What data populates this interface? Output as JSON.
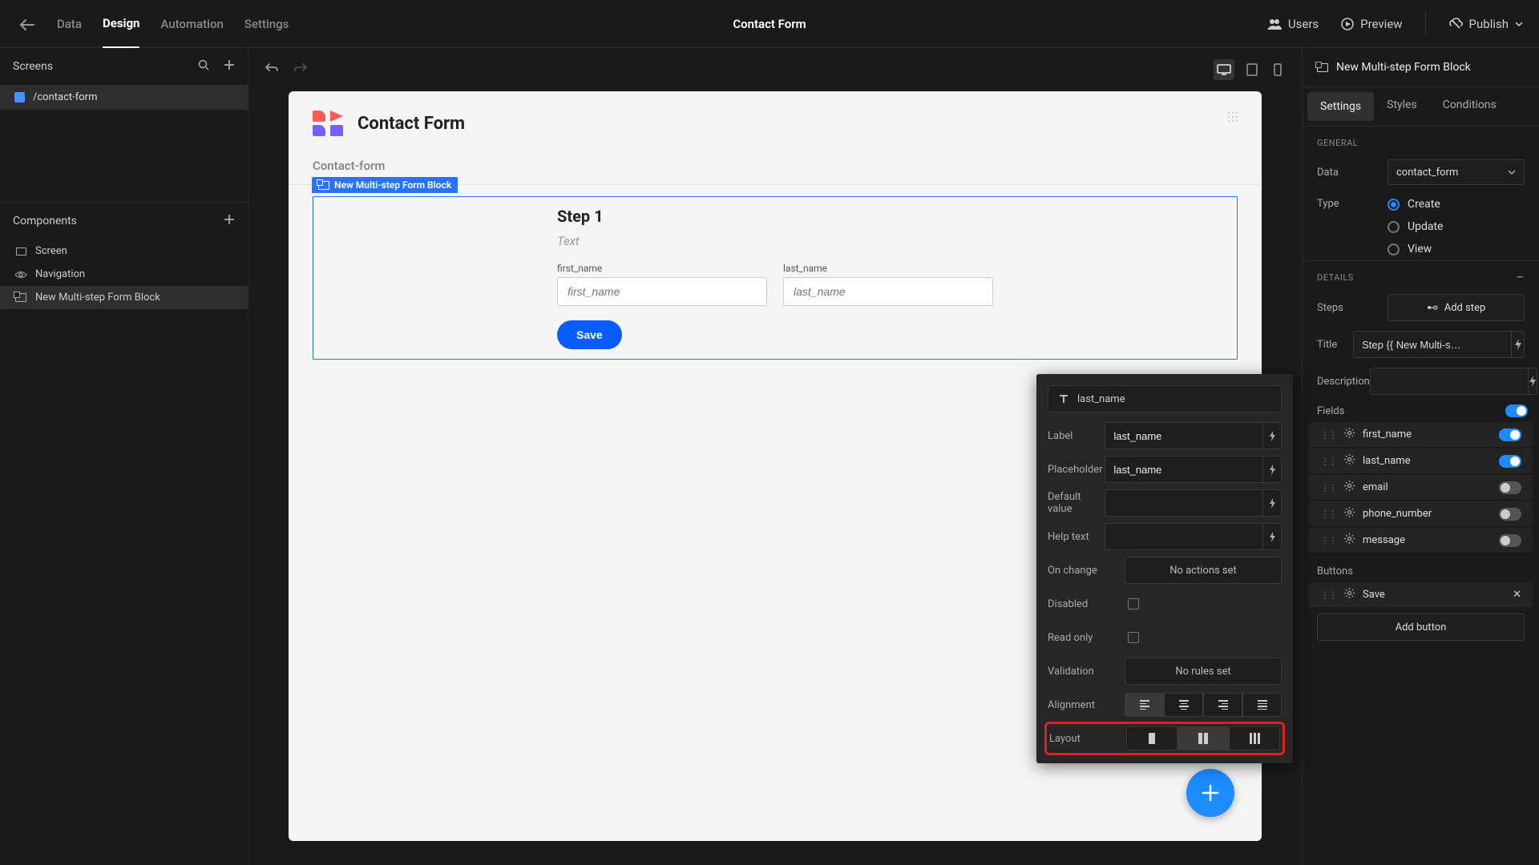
{
  "topbar": {
    "tabs": [
      "Data",
      "Design",
      "Automation",
      "Settings"
    ],
    "active_tab": "Design",
    "title": "Contact Form",
    "users": "Users",
    "preview": "Preview",
    "publish": "Publish"
  },
  "left": {
    "screens_label": "Screens",
    "screen_items": [
      "/contact-form"
    ],
    "components_label": "Components",
    "components": [
      {
        "name": "Screen",
        "icon": "screen",
        "active": false
      },
      {
        "name": "Navigation",
        "icon": "navigation",
        "active": false
      },
      {
        "name": "New Multi-step Form Block",
        "icon": "form",
        "active": true
      }
    ]
  },
  "canvas": {
    "app_title": "Contact Form",
    "section_label": "Contact-form",
    "block_tag": "New Multi-step Form Block",
    "step_title": "Step 1",
    "step_subtitle": "Text",
    "fields": [
      {
        "label": "first_name",
        "placeholder": "first_name"
      },
      {
        "label": "last_name",
        "placeholder": "last_name"
      }
    ],
    "save_label": "Save"
  },
  "field_popup": {
    "field_name": "last_name",
    "rows": {
      "label": {
        "label": "Label",
        "value": "last_name"
      },
      "placeholder": {
        "label": "Placeholder",
        "value": "last_name"
      },
      "default_value": {
        "label": "Default value",
        "value": ""
      },
      "help_text": {
        "label": "Help text",
        "value": ""
      },
      "on_change": {
        "label": "On change",
        "button": "No actions set"
      },
      "disabled": {
        "label": "Disabled",
        "checked": false
      },
      "read_only": {
        "label": "Read only",
        "checked": false
      },
      "validation": {
        "label": "Validation",
        "button": "No rules set"
      },
      "alignment": {
        "label": "Alignment"
      },
      "layout": {
        "label": "Layout"
      }
    }
  },
  "right": {
    "title": "New Multi-step Form Block",
    "tabs": [
      "Settings",
      "Styles",
      "Conditions"
    ],
    "active_tab": "Settings",
    "general_label": "General",
    "data_label": "Data",
    "data_value": "contact_form",
    "type_label": "Type",
    "type_options": [
      "Create",
      "Update",
      "View"
    ],
    "type_selected": "Create",
    "details_label": "Details",
    "steps_label": "Steps",
    "add_step_label": "Add step",
    "title_label": "Title",
    "title_value": "Step {{ New Multi-s…",
    "description_label": "Description",
    "description_value": "",
    "fields_label": "Fields",
    "fields": [
      {
        "name": "first_name",
        "on": true
      },
      {
        "name": "last_name",
        "on": true
      },
      {
        "name": "email",
        "on": false
      },
      {
        "name": "phone_number",
        "on": false
      },
      {
        "name": "message",
        "on": false
      }
    ],
    "buttons_label": "Buttons",
    "button_save": "Save",
    "add_button_label": "Add button"
  }
}
